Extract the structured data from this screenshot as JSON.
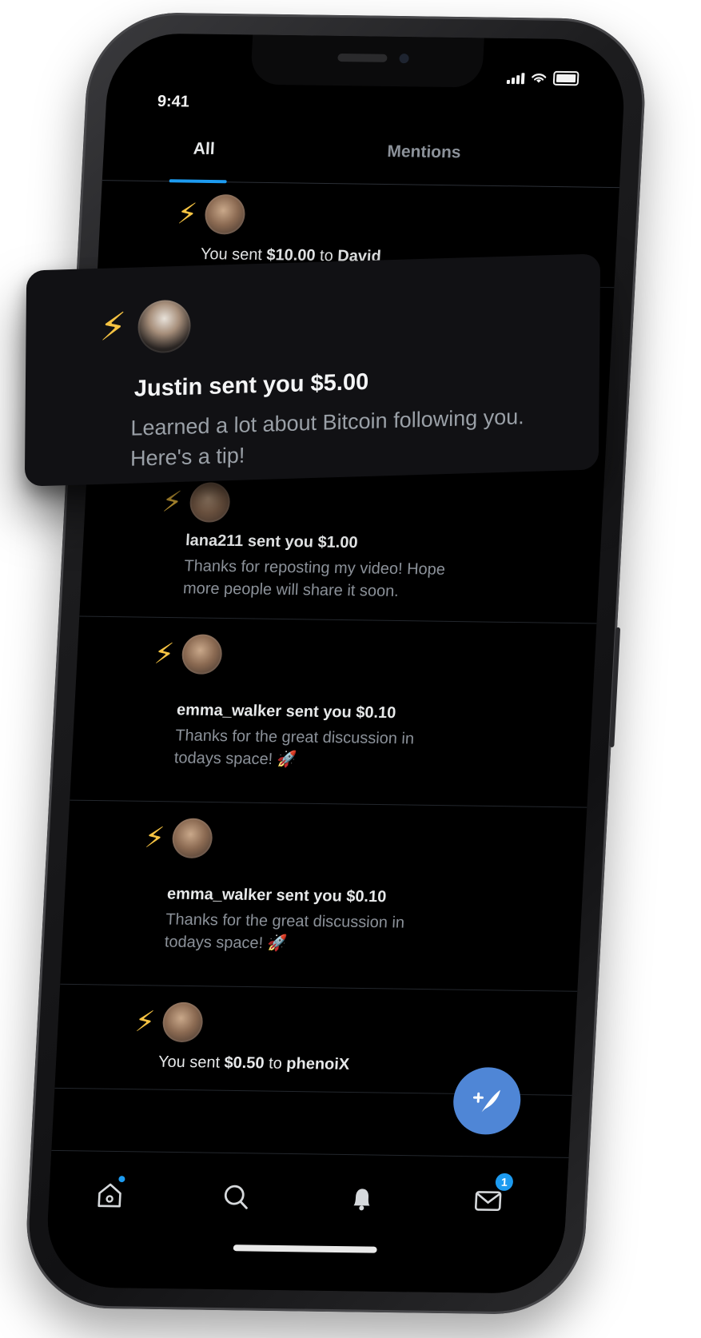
{
  "status_bar": {
    "time": "9:41"
  },
  "tabs": [
    {
      "label": "All",
      "selected": true
    },
    {
      "label": "Mentions",
      "selected": false
    }
  ],
  "notification_card": {
    "title": "Justin sent you $5.00",
    "body": "Learned a lot about Bitcoin following you. Here's a tip!"
  },
  "feed": {
    "items": [
      {
        "kind": "sent",
        "prefix": "You sent",
        "amount": "$10.00",
        "connector": "to",
        "recipient": "David"
      },
      {
        "kind": "received",
        "title": "lana211 sent you $1.00",
        "body": "Thanks for reposting my video! Hope more people will share it soon."
      },
      {
        "kind": "received",
        "title": "emma_walker sent you $0.10",
        "body": "Thanks for the great discussion in todays space! 🚀"
      },
      {
        "kind": "received",
        "title": "emma_walker sent you $0.10",
        "body": "Thanks for the great discussion in todays space! 🚀"
      },
      {
        "kind": "sent",
        "prefix": "You sent",
        "amount": "$0.50",
        "connector": "to",
        "recipient": "phenoiX"
      }
    ]
  },
  "fab": {
    "icon": "compose-icon"
  },
  "bottom_nav": {
    "items": [
      {
        "icon": "home-icon",
        "has_dot": true
      },
      {
        "icon": "search-icon"
      },
      {
        "icon": "bell-icon"
      },
      {
        "icon": "mail-icon",
        "badge": "1"
      }
    ]
  },
  "colors": {
    "accent": "#1d9bf0",
    "fab": "#4f86d6",
    "bolt": "#f6c342",
    "background": "#000000"
  }
}
